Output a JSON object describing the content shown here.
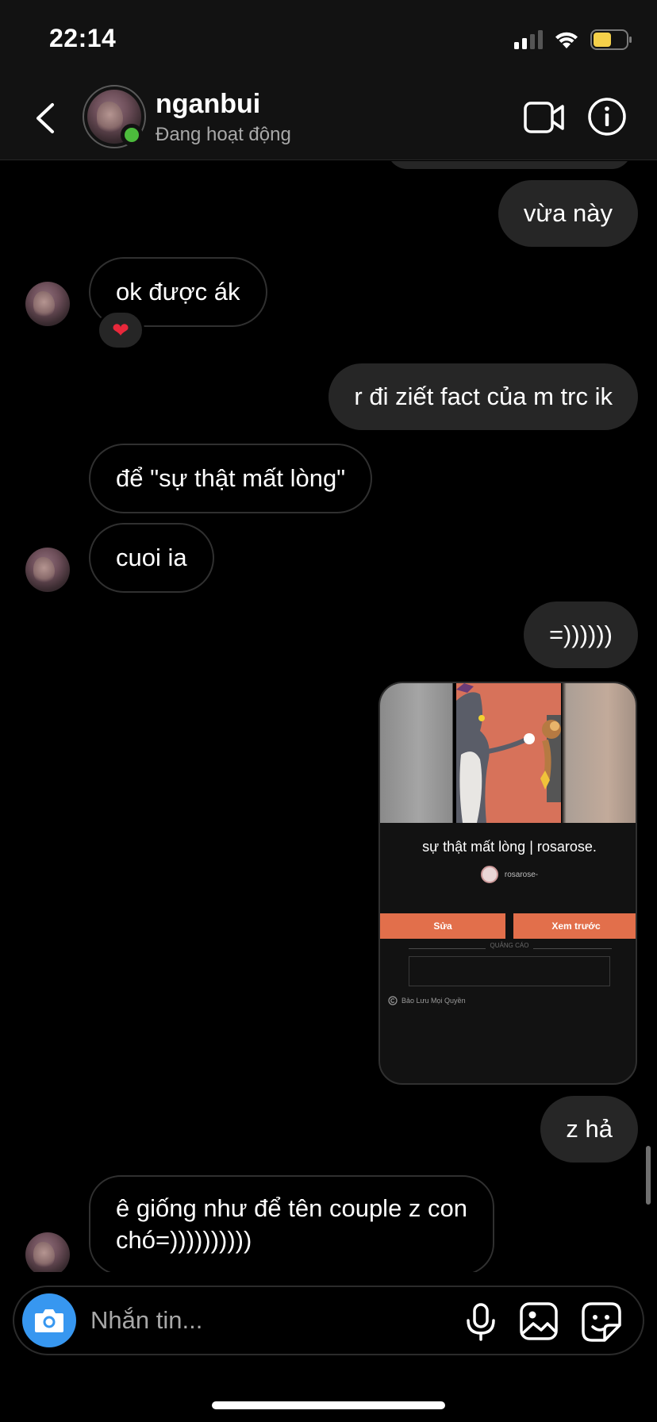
{
  "status_bar": {
    "time": "22:14"
  },
  "header": {
    "contact_name": "nganbui",
    "contact_status": "Đang hoạt động"
  },
  "messages": [
    {
      "side": "out",
      "text": "vừa này"
    },
    {
      "side": "in",
      "text": "ok được ák",
      "reaction": "❤"
    },
    {
      "side": "out",
      "text": "r đi ziết fact của m trc ik"
    },
    {
      "side": "in",
      "text": "để \"sự thật mất lòng\""
    },
    {
      "side": "in",
      "text": "cuoi ia"
    },
    {
      "side": "out",
      "text": "=))))))"
    },
    {
      "side": "out",
      "text": "z hả"
    },
    {
      "side": "in",
      "text_line1": "ê giống như để tên couple z con",
      "text_line2": "chó=))))))))))"
    }
  ],
  "shared_card": {
    "title": "sự thật mất lòng | rosarose.",
    "author": "rosarose-",
    "edit_button": "Sửa",
    "preview_button": "Xem trước",
    "ad_label": "QUẢNG CÁO",
    "footer": "Bảo Lưu Mọi Quyền"
  },
  "composer": {
    "placeholder": "Nhắn tin..."
  },
  "colors": {
    "background": "#000000",
    "header_bg": "#121212",
    "outgoing_bubble": "#262626",
    "online": "#4cbb3c",
    "camera_button": "#3797f0",
    "card_accent": "#e26f4b"
  }
}
